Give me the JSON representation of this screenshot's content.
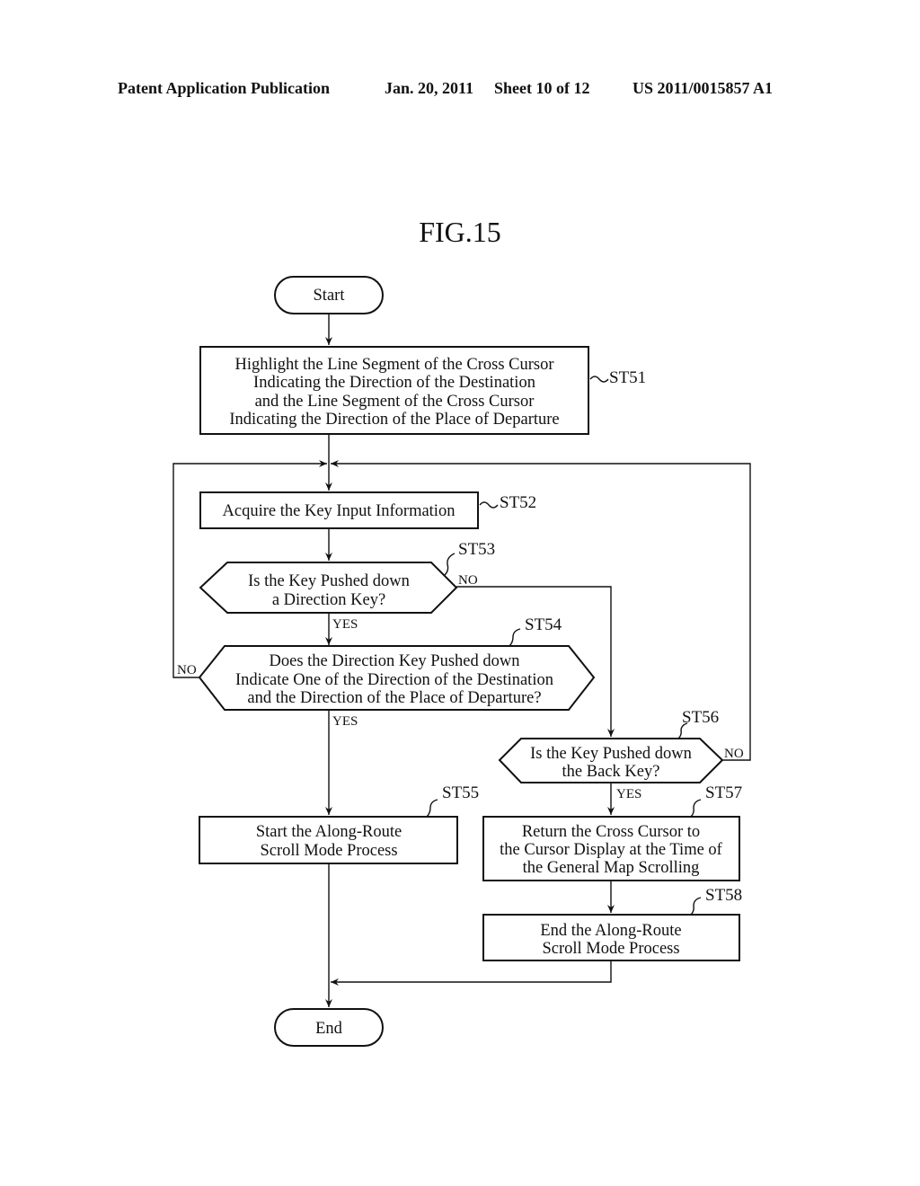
{
  "header": {
    "publication": "Patent Application Publication",
    "date": "Jan. 20, 2011",
    "sheet": "Sheet 10 of 12",
    "number": "US 2011/0015857 A1"
  },
  "figure": {
    "title": "FIG.15"
  },
  "flowchart": {
    "start": "Start",
    "end": "End",
    "steps": {
      "st51": {
        "id": "ST51",
        "lines": [
          "Highlight the Line Segment of the Cross Cursor",
          "Indicating the Direction of the Destination",
          "and the Line Segment of the Cross Cursor",
          "Indicating the Direction of the Place of Departure"
        ]
      },
      "st52": {
        "id": "ST52",
        "lines": [
          "Acquire the Key Input Information"
        ]
      },
      "st53": {
        "id": "ST53",
        "lines": [
          "Is the Key Pushed down",
          "a Direction Key?"
        ]
      },
      "st54": {
        "id": "ST54",
        "lines": [
          "Does the Direction Key Pushed down",
          "Indicate One of the Direction of the Destination",
          "and the Direction of the Place of Departure?"
        ]
      },
      "st55": {
        "id": "ST55",
        "lines": [
          "Start the Along-Route",
          "Scroll Mode Process"
        ]
      },
      "st56": {
        "id": "ST56",
        "lines": [
          "Is the Key Pushed down",
          "the Back Key?"
        ]
      },
      "st57": {
        "id": "ST57",
        "lines": [
          "Return the Cross Cursor to",
          "the Cursor Display at the Time of",
          "the General Map Scrolling"
        ]
      },
      "st58": {
        "id": "ST58",
        "lines": [
          "End the Along-Route",
          "Scroll Mode Process"
        ]
      }
    },
    "branches": {
      "st53_no": "NO",
      "st53_yes": "YES",
      "st54_no": "NO",
      "st54_yes": "YES",
      "st56_no": "NO",
      "st56_yes": "YES"
    }
  }
}
